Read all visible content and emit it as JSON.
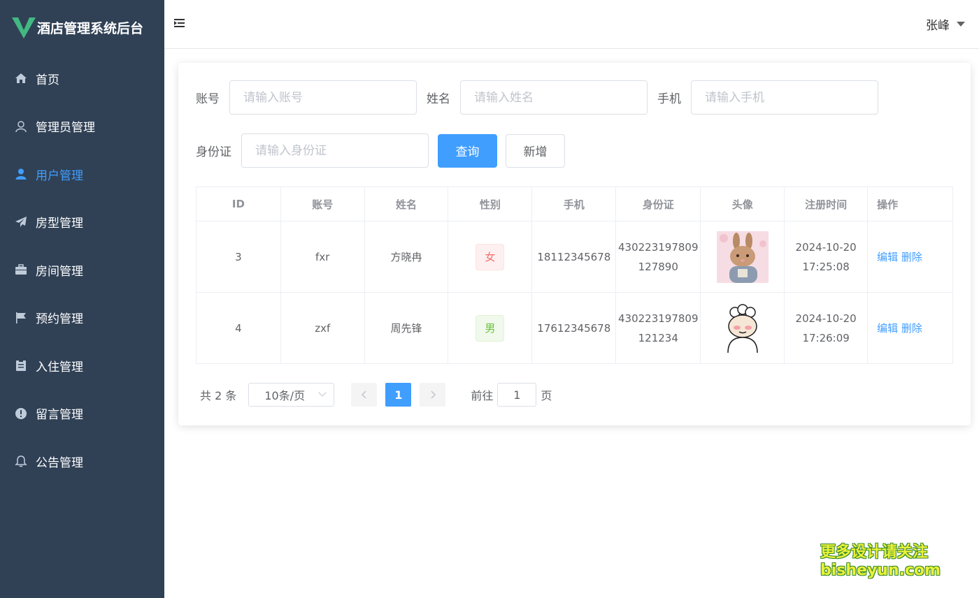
{
  "app": {
    "title": "酒店管理系统后台"
  },
  "sidebar": {
    "items": [
      {
        "label": "首页",
        "icon": "home-icon"
      },
      {
        "label": "管理员管理",
        "icon": "user-outline-icon"
      },
      {
        "label": "用户管理",
        "icon": "user-solid-icon",
        "active": true
      },
      {
        "label": "房型管理",
        "icon": "paper-plane-icon"
      },
      {
        "label": "房间管理",
        "icon": "briefcase-icon"
      },
      {
        "label": "预约管理",
        "icon": "flag-icon"
      },
      {
        "label": "入住管理",
        "icon": "clipboard-icon"
      },
      {
        "label": "留言管理",
        "icon": "warning-circle-icon"
      },
      {
        "label": "公告管理",
        "icon": "bell-icon"
      }
    ]
  },
  "header": {
    "user_name": "张峰"
  },
  "search": {
    "account_label": "账号",
    "account_placeholder": "请输入账号",
    "account_value": "",
    "name_label": "姓名",
    "name_placeholder": "请输入姓名",
    "name_value": "",
    "phone_label": "手机",
    "phone_placeholder": "请输入手机",
    "phone_value": "",
    "idcard_label": "身份证",
    "idcard_placeholder": "请输入身份证",
    "idcard_value": "",
    "query_label": "查询",
    "add_label": "新增"
  },
  "table": {
    "columns": [
      "ID",
      "账号",
      "姓名",
      "性别",
      "手机",
      "身份证",
      "头像",
      "注册时间",
      "操作"
    ],
    "rows": [
      {
        "id": "3",
        "account": "fxr",
        "name": "方晓冉",
        "gender": "女",
        "phone": "18112345678",
        "idcard": "430223197809127890",
        "avatar": "rabbit-avatar",
        "register_time": "2024-10-20 17:25:08",
        "edit": "编辑",
        "delete": "删除"
      },
      {
        "id": "4",
        "account": "zxf",
        "name": "周先锋",
        "gender": "男",
        "phone": "17612345678",
        "idcard": "430223197809121234",
        "avatar": "sheep-avatar",
        "register_time": "2024-10-20 17:26:09",
        "edit": "编辑",
        "delete": "删除"
      }
    ]
  },
  "pagination": {
    "total_text": "共 2 条",
    "page_size": "10条/页",
    "current_page": "1",
    "goto_label": "前往",
    "goto_value": "1",
    "page_suffix": "页"
  },
  "watermark": {
    "line1": "更多设计请关注",
    "line2": "bisheyun.com"
  },
  "colors": {
    "sidebar_bg": "#304156",
    "accent": "#409eff",
    "logo_green": "#42b983"
  }
}
